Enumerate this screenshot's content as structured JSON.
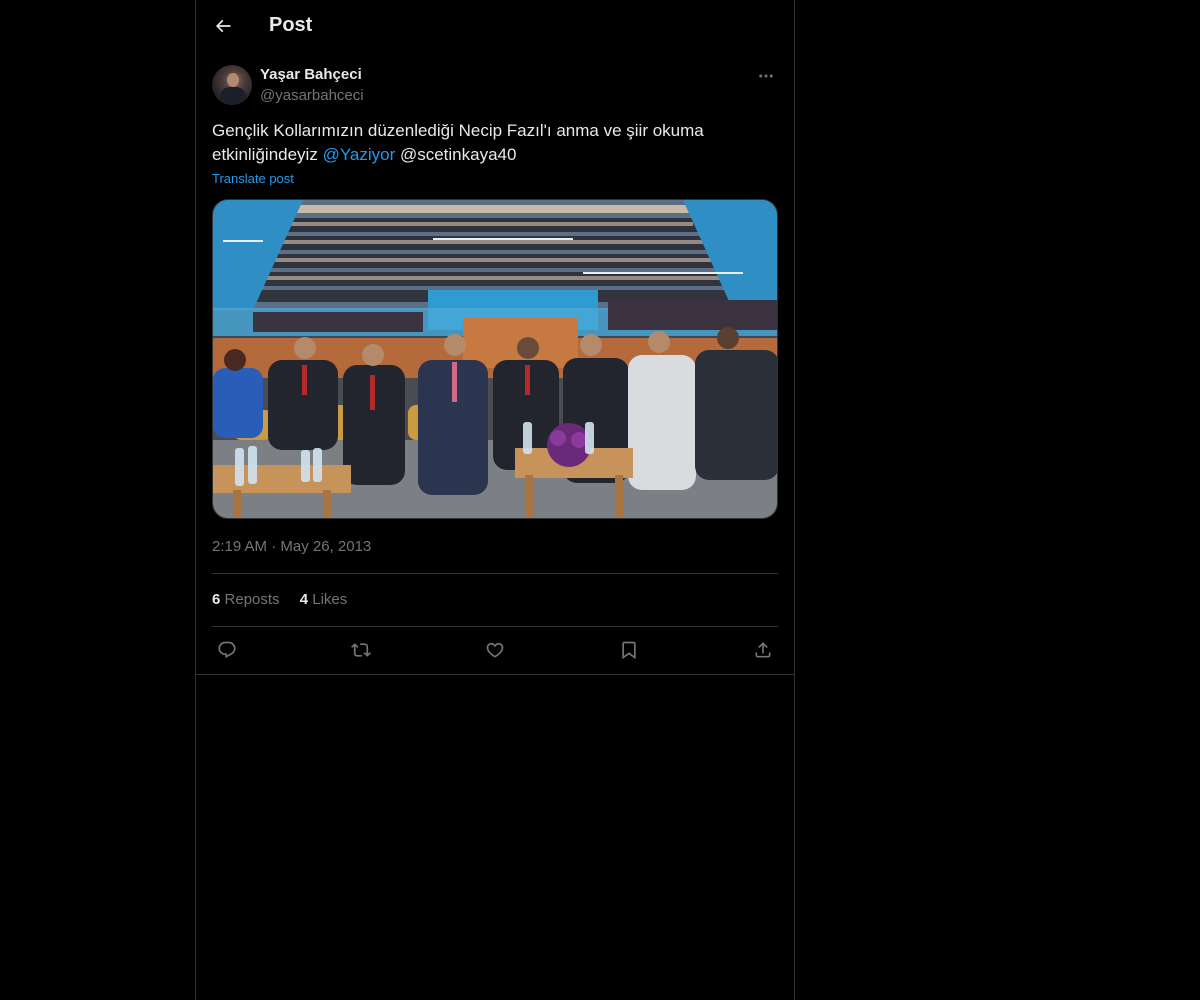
{
  "header": {
    "title": "Post",
    "back_icon": "arrow-left-icon"
  },
  "author": {
    "name": "Yaşar Bahçeci",
    "handle": "@yasarbahceci"
  },
  "post": {
    "text_part1": "Gençlik Kollarımızın düzenlediği Necip Fazıl'ı anma ve şiir okuma etkinliğindeyiz ",
    "mention1": "@Yaziyor",
    "text_part2": " @scetinkaya40",
    "translate_label": "Translate post",
    "timestamp": "2:19 AM · May 26, 2013"
  },
  "stats": {
    "reposts_count": "6",
    "reposts_label": "Reposts",
    "likes_count": "4",
    "likes_label": "Likes"
  },
  "actions": [
    {
      "name": "reply",
      "icon": "reply-icon"
    },
    {
      "name": "repost",
      "icon": "repost-icon"
    },
    {
      "name": "like",
      "icon": "heart-icon"
    },
    {
      "name": "bookmark",
      "icon": "bookmark-icon"
    },
    {
      "name": "share",
      "icon": "share-icon"
    }
  ],
  "colors": {
    "background": "#000000",
    "text_primary": "#e7e9ea",
    "text_secondary": "#71767b",
    "accent": "#1d9bf0",
    "border": "#2f3336"
  }
}
